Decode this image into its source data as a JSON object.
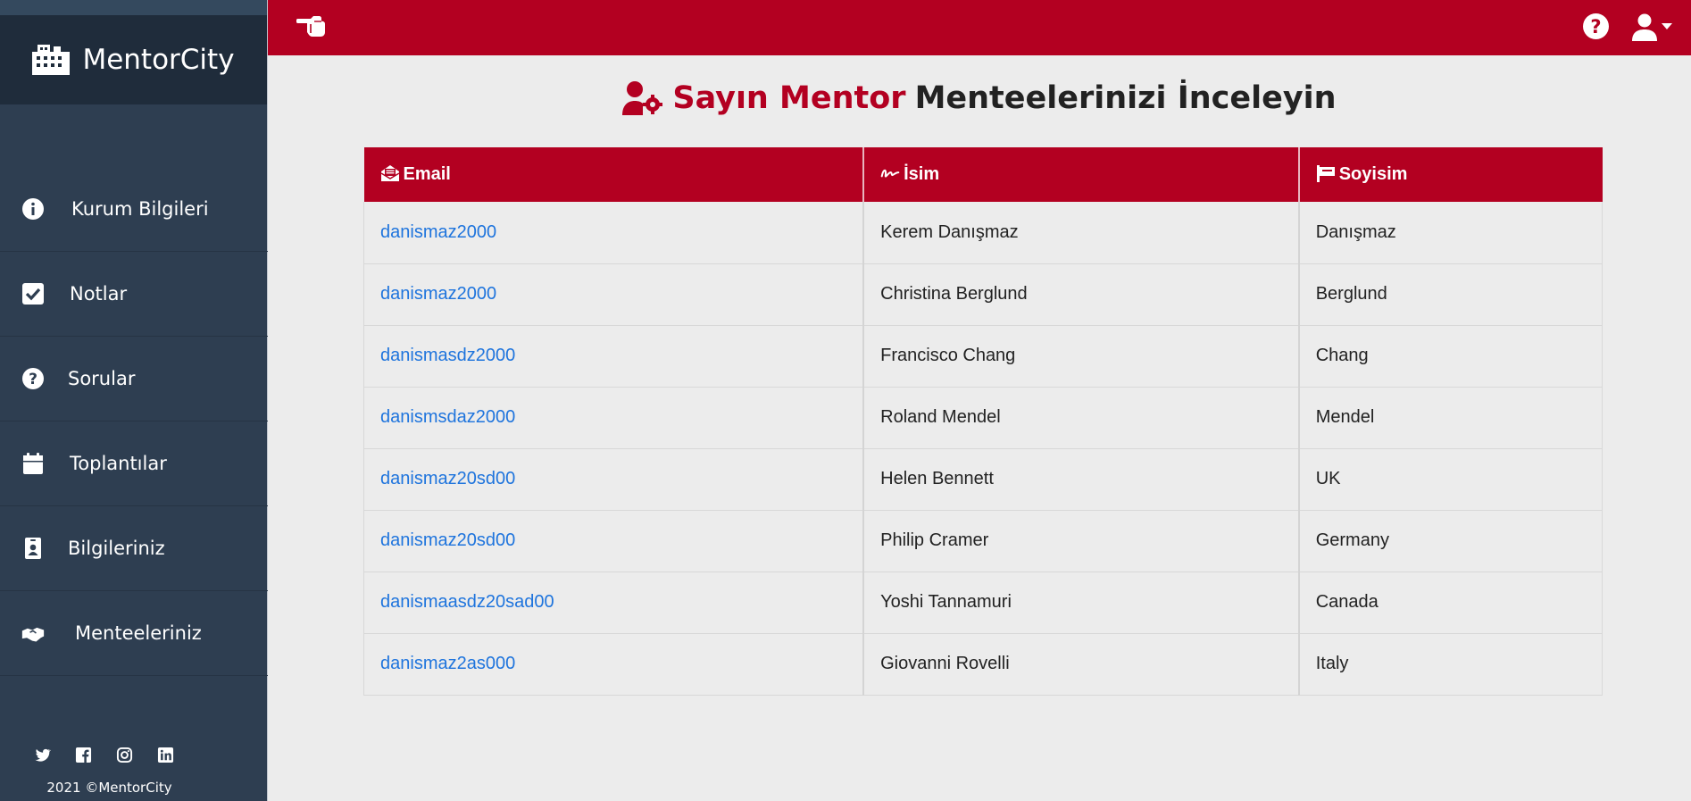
{
  "app": {
    "brand": "MentorCity",
    "copyright": "2021 ©MentorCity"
  },
  "sidebar": {
    "items": [
      {
        "label": "Kurum Bilgileri",
        "icon": "info-circle-icon"
      },
      {
        "label": "Notlar",
        "icon": "check-square-icon"
      },
      {
        "label": "Sorular",
        "icon": "question-circle-icon"
      },
      {
        "label": "Toplantılar",
        "icon": "calendar-icon"
      },
      {
        "label": "Bilgileriniz",
        "icon": "id-badge-icon"
      },
      {
        "label": "Menteeleriniz",
        "icon": "handshake-icon"
      }
    ],
    "socials": [
      "twitter-icon",
      "facebook-icon",
      "instagram-icon",
      "linkedin-icon"
    ]
  },
  "topbar": {
    "toggle_icon": "hand-point-left-icon",
    "help_icon": "question-circle-icon",
    "user_icon": "user-icon"
  },
  "page": {
    "title_accent": "Sayın Mentor",
    "title_rest": "Menteelerinizi İnceleyin"
  },
  "table": {
    "columns": [
      {
        "label": "Email",
        "icon": "envelope-open-icon"
      },
      {
        "label": "İsim",
        "icon": "signature-icon"
      },
      {
        "label": "Soyisim",
        "icon": "flag-icon"
      }
    ],
    "rows": [
      {
        "email": "danismaz2000",
        "name": "Kerem Danışmaz",
        "surname": "Danışmaz"
      },
      {
        "email": "danismaz2000",
        "name": "Christina Berglund",
        "surname": "Berglund"
      },
      {
        "email": "danismasdz2000",
        "name": "Francisco Chang",
        "surname": "Chang"
      },
      {
        "email": "danismsdaz2000",
        "name": "Roland Mendel",
        "surname": "Mendel"
      },
      {
        "email": "danismaz20sd00",
        "name": "Helen Bennett",
        "surname": "UK"
      },
      {
        "email": "danismaz20sd00",
        "name": "Philip Cramer",
        "surname": "Germany"
      },
      {
        "email": "danismaasdz20sad00",
        "name": "Yoshi Tannamuri",
        "surname": "Canada"
      },
      {
        "email": "danismaz2as000",
        "name": "Giovanni Rovelli",
        "surname": "Italy"
      }
    ]
  },
  "colors": {
    "accent": "#b30021",
    "sidebar": "#2e3e51",
    "brand_bg": "#1f2c3b",
    "link": "#1e74dd",
    "page_bg": "#ececec"
  }
}
